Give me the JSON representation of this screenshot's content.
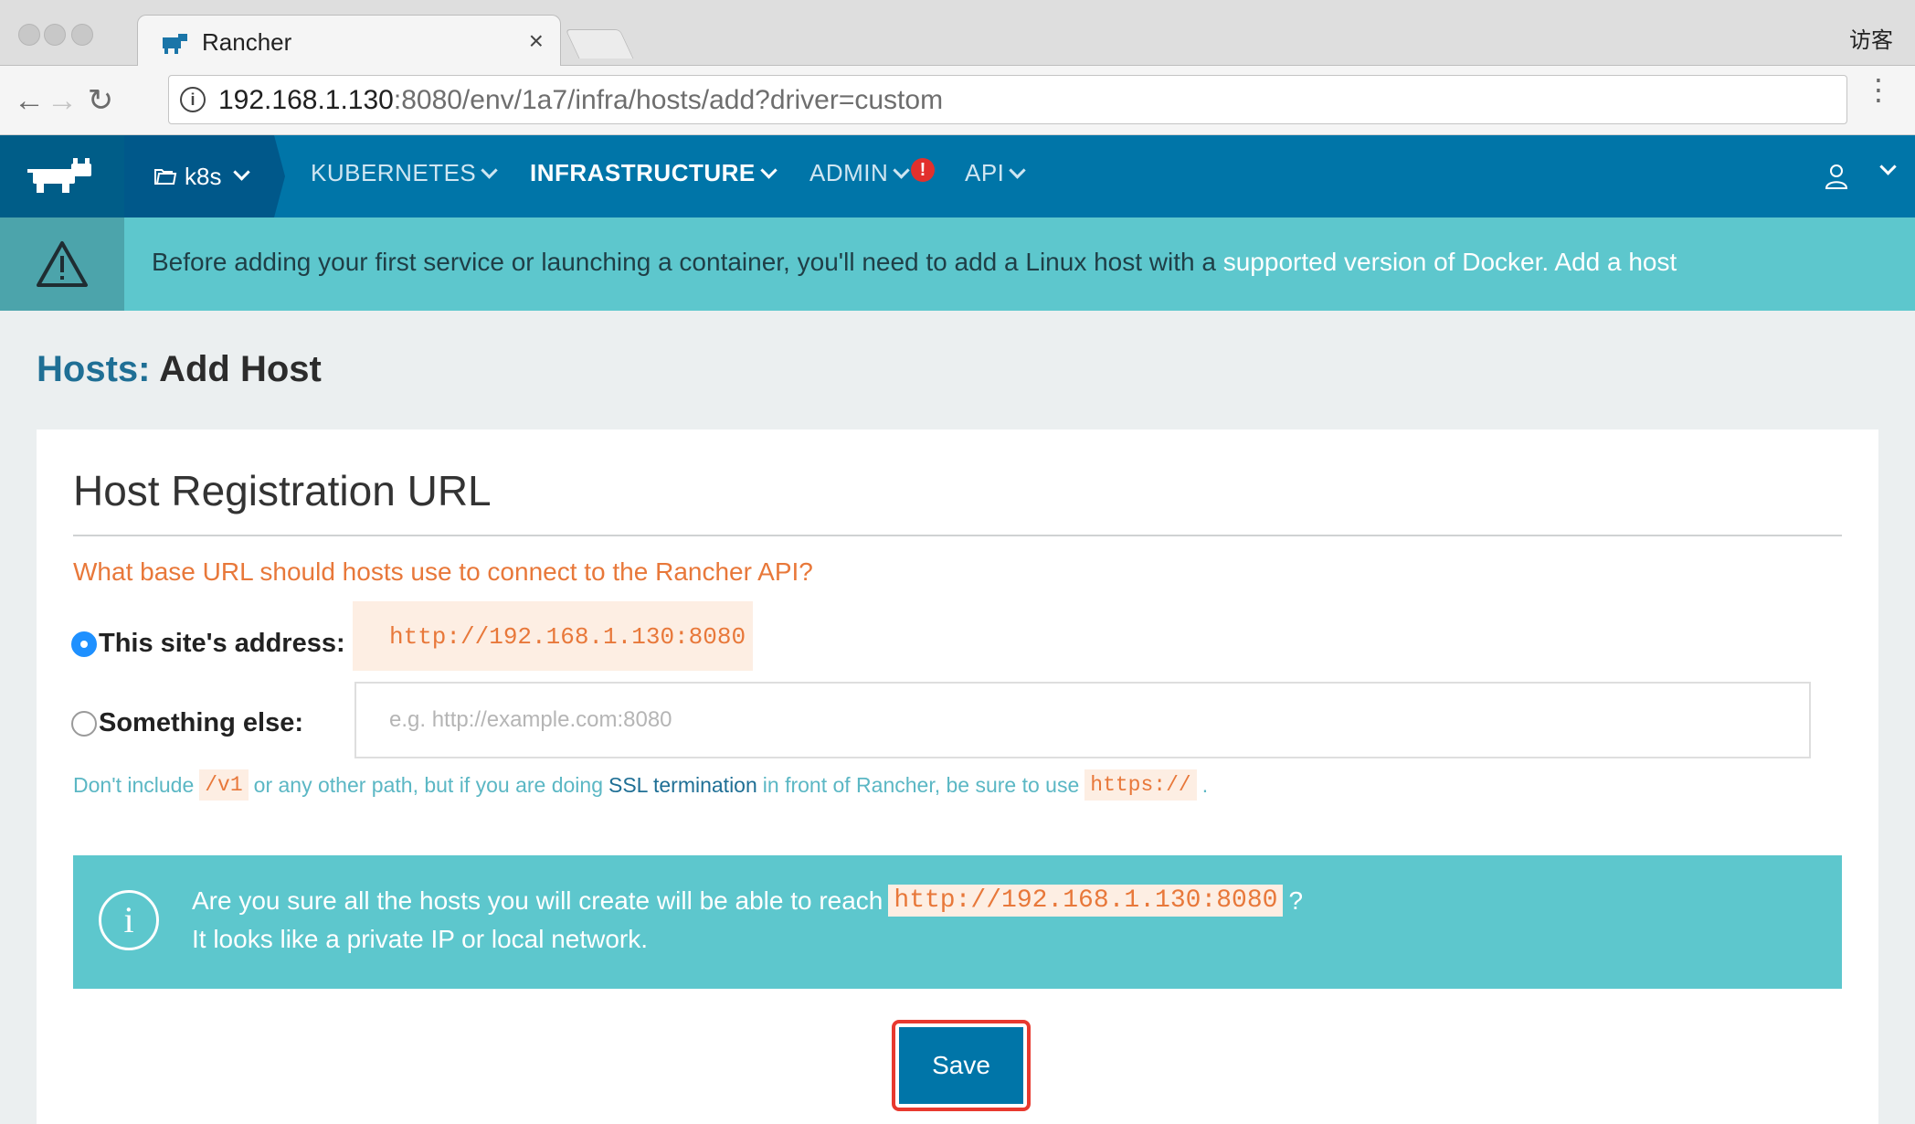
{
  "browser": {
    "tab_title": "Rancher",
    "tab_close": "×",
    "guest_label": "访客",
    "url_host": "192.168.1.130",
    "url_rest": ":8080/env/1a7/infra/hosts/add?driver=custom",
    "menu_dots": "⋮"
  },
  "header": {
    "environment": "k8s",
    "nav": [
      {
        "label": "KUBERNETES",
        "active": false
      },
      {
        "label": "INFRASTRUCTURE",
        "active": true
      },
      {
        "label": "ADMIN",
        "active": false
      },
      {
        "label": "API",
        "active": false
      }
    ],
    "alert_badge": "!"
  },
  "banner": {
    "text": "Before adding your first service or launching a container, you'll need to add a Linux host with a",
    "link_docker": "supported version of Docker.",
    "link_add_host": "Add a host"
  },
  "page": {
    "crumb": "Hosts:",
    "title": "Add Host"
  },
  "registration": {
    "heading": "Host Registration URL",
    "question": "What base URL should hosts use to connect to the Rancher API?",
    "option_site_label": "This site's address:",
    "option_site_value": "http://192.168.1.130:8080",
    "option_site_selected": true,
    "option_else_label": "Something else:",
    "option_else_placeholder": "e.g. http://example.com:8080",
    "option_else_value": "",
    "hint_part1": "Don't include",
    "hint_code1": "/v1",
    "hint_part2": "or any other path, but if you are doing",
    "hint_link": "SSL termination",
    "hint_part3": "in front of Rancher, be sure to use",
    "hint_code2": "https://",
    "hint_part4": "."
  },
  "info": {
    "icon": "i",
    "line1_prefix": "Are you sure all the hosts you will create will be able to reach",
    "line1_code": "http://192.168.1.130:8080",
    "line1_suffix": "?",
    "line2": "It looks like a private IP or local network."
  },
  "actions": {
    "save_label": "Save"
  },
  "colors": {
    "brand": "#0075a8",
    "banner": "#5dc7cd",
    "accent_orange": "#e8783a",
    "highlight_red": "#e8392f"
  }
}
